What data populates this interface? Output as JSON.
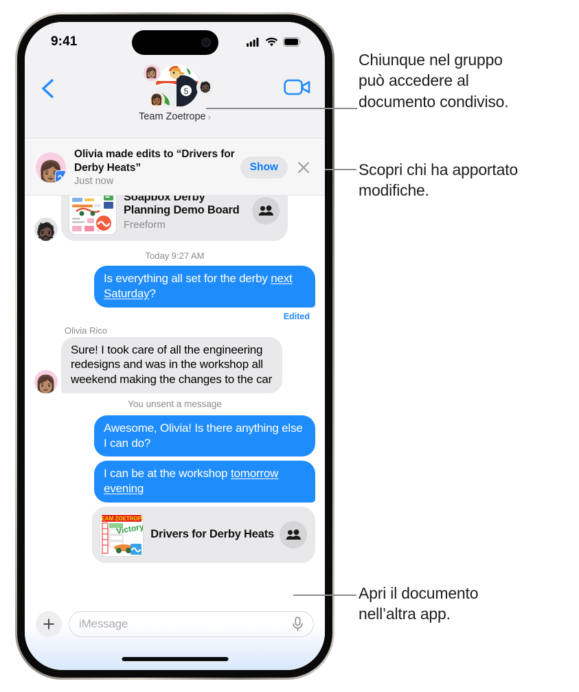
{
  "statusbar": {
    "time": "9:41",
    "cellular_icon": "cellular-bars-icon",
    "wifi_icon": "wifi-icon",
    "battery_icon": "battery-icon"
  },
  "navbar": {
    "back_icon": "back-chevron-icon",
    "facetime_icon": "video-camera-icon",
    "group_name": "Team Zoetrope",
    "group_chevron": "›",
    "avatars": [
      {
        "name": "group-avatar-main",
        "glyph": "🏎"
      },
      {
        "name": "group-avatar-olivia",
        "glyph": "👩🏽"
      },
      {
        "name": "group-avatar-member-2",
        "glyph": "🧔🏿"
      },
      {
        "name": "group-avatar-member-3",
        "glyph": "👩🏾"
      }
    ]
  },
  "notification": {
    "avatar_glyph": "👩🏽",
    "app_badge_icon": "freeform-app-icon",
    "title": "Olivia made edits to “Drivers for Derby Heats”",
    "subtitle": "Just now",
    "show_label": "Show",
    "close_icon": "close-x-icon"
  },
  "conversation": {
    "freeform_card": {
      "avatar_glyph": "🧔🏿",
      "title": "Soapbox Derby Planning Demo Board",
      "subtitle": "Freeform",
      "people_icon": "shared-with-you-people-icon",
      "thumbnail": "freeform-board-thumbnail"
    },
    "timestamp": "Today 9:27 AM",
    "messages": [
      {
        "id": "msg-1",
        "direction": "out",
        "text_before": "Is everything all set for the derby ",
        "link_text": "next Saturday",
        "text_after": "?",
        "edited_label": "Edited"
      },
      {
        "id": "msg-2",
        "direction": "in",
        "sender": "Olivia Rico",
        "avatar_glyph": "👩🏽",
        "text": "Sure! I took care of all the engineering redesigns and was in the workshop all weekend making the changes to the car"
      },
      {
        "id": "msg-3",
        "direction": "out",
        "text_before": "Awesome, Olivia! Is there anything else I can do?",
        "link_text": "",
        "text_after": ""
      },
      {
        "id": "msg-4",
        "direction": "out",
        "text_before": "I can be at the workshop ",
        "link_text": "tomorrow evening",
        "text_after": ""
      }
    ],
    "system_message": "You unsent a message",
    "document_card": {
      "title": "Drivers for Derby Heats",
      "people_icon": "shared-with-you-people-icon",
      "thumbnail": "drivers-for-derby-heats-thumbnail",
      "thumbnail_banner": "TEAM ZOETROPE",
      "thumbnail_word": "Victory!"
    }
  },
  "inputbar": {
    "plus_icon": "add-attachment-icon",
    "placeholder": "iMessage",
    "mic_icon": "microphone-icon"
  },
  "callouts": [
    {
      "id": "callout-1",
      "line1": "Chiunque nel gruppo",
      "line2": "può accedere al",
      "line3": "documento condiviso."
    },
    {
      "id": "callout-2",
      "line1": "Scopri chi ha apportato",
      "line2": "modifiche.",
      "line3": ""
    },
    {
      "id": "callout-3",
      "line1": "Apri il documento",
      "line2": "nell’altra app.",
      "line3": ""
    }
  ],
  "colors": {
    "accent_blue": "#1f8cfb",
    "link_blue": "#0a7bff",
    "bubble_gray": "#e9e9eb",
    "nav_gray": "#f2f2f4",
    "text_secondary": "#8a8a8e",
    "leader_line": "#8c8c8c"
  }
}
